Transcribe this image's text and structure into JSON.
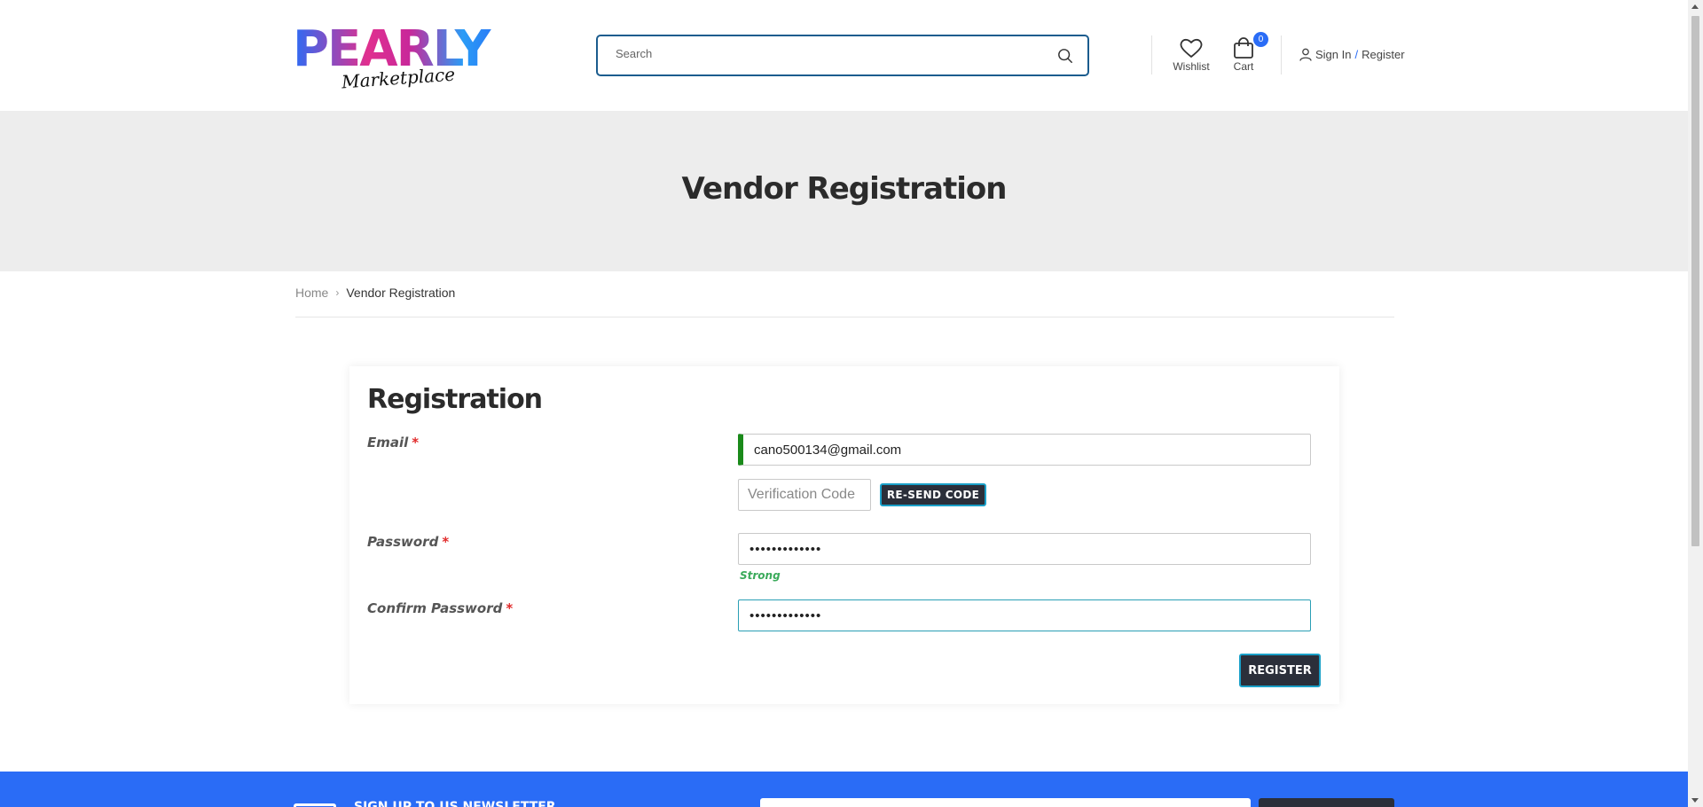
{
  "header": {
    "logo_main": "PEARLY",
    "logo_sub": "Marketplace",
    "search_placeholder": "Search",
    "wishlist_label": "Wishlist",
    "cart_label": "Cart",
    "cart_count": "0",
    "signin_label": "Sign In",
    "signin_separator": "/",
    "register_label": "Register"
  },
  "banner": {
    "title": "Vendor Registration"
  },
  "breadcrumb": {
    "home": "Home",
    "separator": ">",
    "current": "Vendor Registration"
  },
  "form": {
    "heading": "Registration",
    "required_mark": "*",
    "email_label": "Email",
    "email_value": "cano500134@gmail.com",
    "verification_placeholder": "Verification Code",
    "resend_label": "RE-SEND CODE",
    "password_label": "Password",
    "password_value": "•••••••••••••",
    "password_strength": "Strong",
    "confirm_label": "Confirm Password",
    "confirm_value": "•••••••••••••",
    "register_label": "REGISTER"
  },
  "newsletter": {
    "text": "SIGN UP TO US NEWSLETTER"
  },
  "colors": {
    "accent_blue": "#2a6cf6",
    "button_dark": "#2b2f3a",
    "strength_green": "#3aaa5a",
    "required_red": "#e12a2a",
    "email_valid_bar": "#1a8a1a"
  }
}
